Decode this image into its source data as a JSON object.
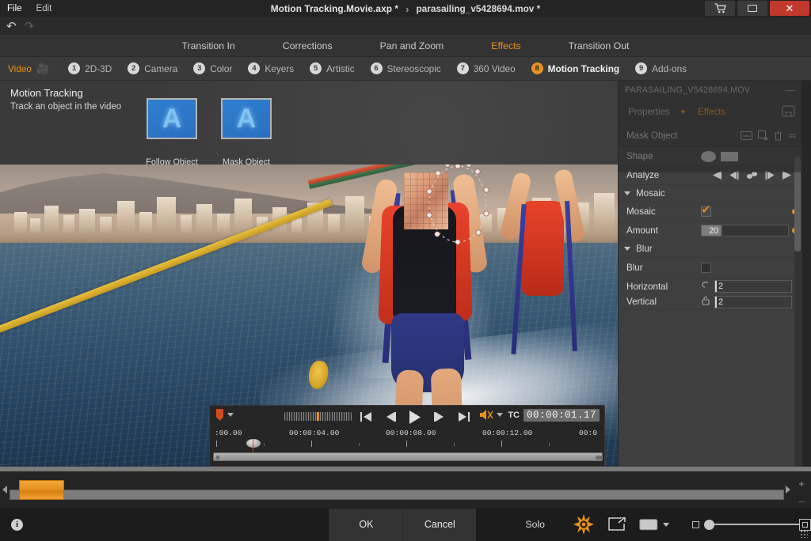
{
  "window": {
    "menus": [
      "File",
      "Edit"
    ],
    "doc_title": "Motion Tracking.Movie.axp *",
    "title_separator": "›",
    "clip_title": "parasailing_v5428694.mov *",
    "cart_icon": "cart-icon",
    "minimize_icon": "minimize-icon",
    "close_label": "✕",
    "undo_icon": "undo-icon",
    "redo_icon": "redo-icon"
  },
  "top_tabs": [
    {
      "label": "Transition In",
      "active": false
    },
    {
      "label": "Corrections",
      "active": false
    },
    {
      "label": "Pan and Zoom",
      "active": false
    },
    {
      "label": "Effects",
      "active": true
    },
    {
      "label": "Transition Out",
      "active": false
    }
  ],
  "categories": [
    {
      "num": "",
      "label": "Video",
      "active": false,
      "is_video": true
    },
    {
      "num": "1",
      "label": "2D-3D",
      "active": false
    },
    {
      "num": "2",
      "label": "Camera",
      "active": false
    },
    {
      "num": "3",
      "label": "Color",
      "active": false
    },
    {
      "num": "4",
      "label": "Keyers",
      "active": false
    },
    {
      "num": "5",
      "label": "Artistic",
      "active": false
    },
    {
      "num": "6",
      "label": "Stereoscopic",
      "active": false
    },
    {
      "num": "7",
      "label": "360 Video",
      "active": false
    },
    {
      "num": "8",
      "label": "Motion Tracking",
      "active": true
    },
    {
      "num": "9",
      "label": "Add-ons",
      "active": false
    }
  ],
  "effect_browser": {
    "title": "Motion Tracking",
    "subtitle": "Track an object in the video",
    "items": [
      {
        "label": "Follow Object",
        "glyph": "A"
      },
      {
        "label": "Mask Object",
        "glyph": "A"
      }
    ]
  },
  "properties_panel": {
    "filename": "PARASAILING_V5428694.MOV",
    "collapse_label": "—",
    "tabs": [
      {
        "label": "Properties",
        "active": false
      },
      {
        "label": "Effects",
        "active": true
      }
    ],
    "save_icon": "save-preset-icon",
    "object_name": "Mask Object",
    "object_icons": [
      "rename-icon",
      "add-mask-icon",
      "delete-icon",
      "menu-icon"
    ],
    "rows": [
      {
        "name": "shape",
        "label": "Shape",
        "type": "shape-toggle"
      },
      {
        "name": "analyze",
        "label": "Analyze",
        "type": "analyze"
      }
    ],
    "groups": [
      {
        "title": "Mosaic",
        "rows": [
          {
            "name": "mosaic",
            "label": "Mosaic",
            "type": "checkbox",
            "checked": true,
            "keyframe": true
          },
          {
            "name": "amount",
            "label": "Amount",
            "type": "slider",
            "value": "20",
            "keyframe": true
          }
        ]
      },
      {
        "title": "Blur",
        "rows": [
          {
            "name": "blur",
            "label": "Blur",
            "type": "checkbox",
            "checked": false
          },
          {
            "name": "horizontal",
            "label": "Horizontal",
            "type": "field",
            "value": "2"
          },
          {
            "name": "vertical",
            "label": "Vertical",
            "type": "field",
            "value": "2"
          }
        ]
      }
    ]
  },
  "transport": {
    "marker_icon": "marker-icon",
    "marker_caret": "chevron-down-icon",
    "jog_icon": "jog-shuttle",
    "buttons": [
      {
        "name": "go-to-start-button",
        "icon": "skip-to-start-icon"
      },
      {
        "name": "step-back-button",
        "icon": "step-backward-icon"
      },
      {
        "name": "play-button",
        "icon": "play-icon"
      },
      {
        "name": "step-forward-button",
        "icon": "step-forward-icon"
      },
      {
        "name": "go-to-end-button",
        "icon": "skip-to-end-icon"
      }
    ],
    "audio_icon": "mute-icon",
    "audio_caret": "chevron-down-icon",
    "tc_label": "TC",
    "tc_value": "00:00:01.17",
    "ruler_labels": [
      ":00.00",
      "00:00:04.00",
      "00:00:08.00",
      "00:00:12.00",
      "00:0"
    ]
  },
  "timeline": {
    "left_arrow": "scroll-left-icon",
    "right_arrow": "scroll-right-icon",
    "zoom_in": "+",
    "zoom_out": "–"
  },
  "bottom_bar": {
    "info_icon": "i",
    "ok_label": "OK",
    "cancel_label": "Cancel",
    "solo_label": "Solo",
    "tools": [
      "color-target-icon",
      "export-frame-icon",
      "display-mode-icon"
    ],
    "display_caret": "chevron-down-icon",
    "zoom_small_icon": "zoom-out-icon",
    "zoom_large_icon": "zoom-in-icon",
    "resize-grip": "resize-grip-icon"
  },
  "colors": {
    "accent": "#e8921f",
    "close_red": "#c0392b",
    "panel_bg": "#3f3f3f",
    "chrome_bg": "#333333",
    "playhead_red": "#e03a1e"
  }
}
